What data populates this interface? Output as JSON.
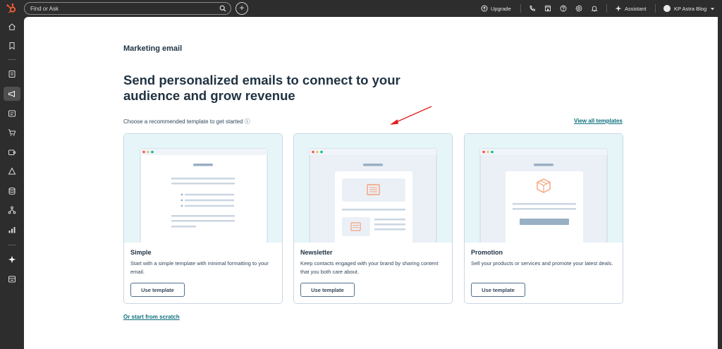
{
  "topbar": {
    "search_placeholder": "Find or Ask",
    "upgrade_label": "Upgrade",
    "assistant_label": "Assistant",
    "account_label": "KP Astra Blog"
  },
  "main": {
    "breadcrumb": "Marketing email",
    "headline": "Send personalized emails to connect to your audience and grow revenue",
    "subline": "Choose a recommended template to get started",
    "info_glyph": "ⓘ",
    "view_all": "View all templates",
    "start_scratch": "Or start from scratch"
  },
  "cards": [
    {
      "title": "Simple",
      "desc": "Start with a simple template with minimal formatting to your email.",
      "button": "Use template"
    },
    {
      "title": "Newsletter",
      "desc": "Keep contacts engaged with your brand by sharing content that you both care about.",
      "button": "Use template"
    },
    {
      "title": "Promotion",
      "desc": "Sell your products or services and promote your latest deals.",
      "button": "Use template"
    }
  ],
  "colors": {
    "chrome": "#2d2d2d",
    "accent_link": "#0b6f7c",
    "preview_bg": "#e5f5f8",
    "arrow": "#e0201e",
    "icon_orange": "#f5a07a"
  }
}
